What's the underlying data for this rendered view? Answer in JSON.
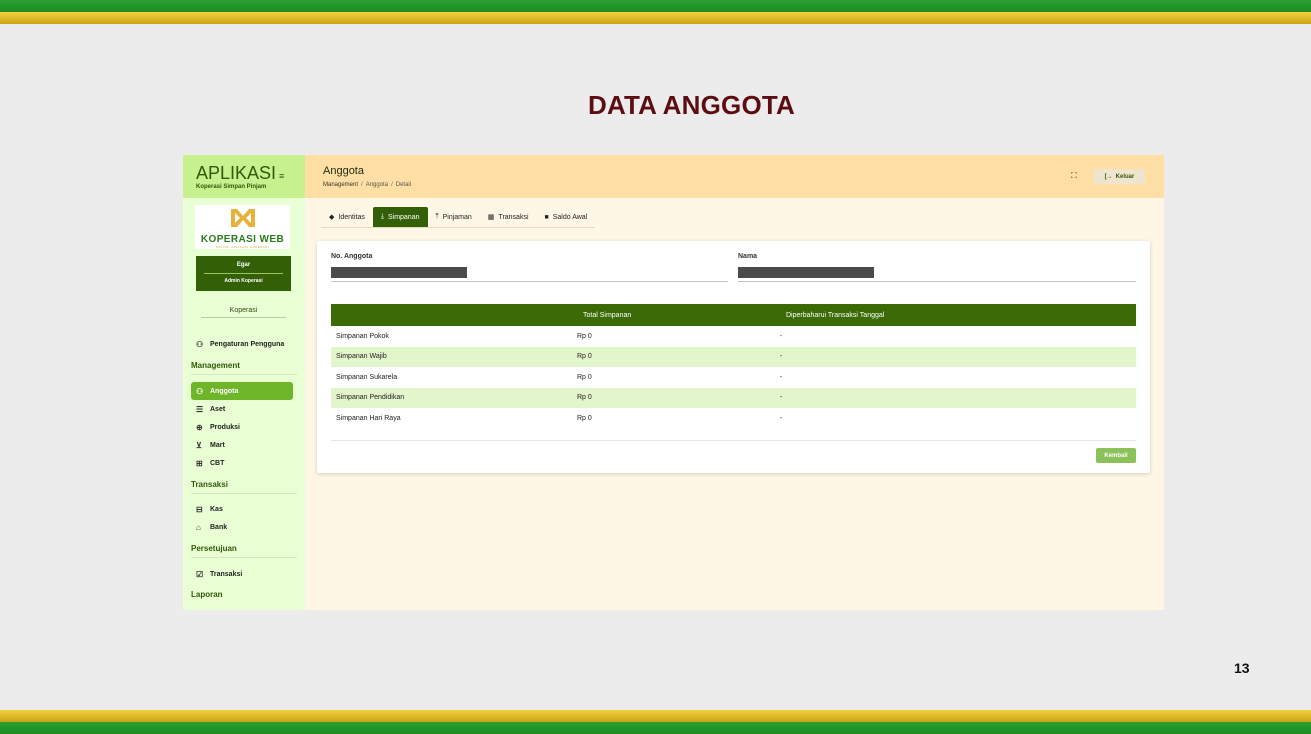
{
  "slide": {
    "title": "DATA ANGGOTA",
    "page_number": "13"
  },
  "sidebar": {
    "app_name": "APLIKASI",
    "app_subtitle": "Koperasi Simpan Pinjam",
    "logo_text": "KOPERASI WEB",
    "logo_tagline": "SOLUSI APLIKASI KOPERASI",
    "user_name": "Egar",
    "user_role": "Admin Koperasi",
    "org_label": "Koperasi",
    "items": [
      {
        "label": "Pengaturan Pengguna",
        "icon": "users-icon"
      },
      {
        "label": "Anggota",
        "icon": "users-icon",
        "active": true
      },
      {
        "label": "Aset",
        "icon": "server-icon"
      },
      {
        "label": "Produksi",
        "icon": "globe-icon"
      },
      {
        "label": "Mart",
        "icon": "cart-icon"
      },
      {
        "label": "CBT",
        "icon": "building-icon"
      },
      {
        "label": "Kas",
        "icon": "inbox-icon"
      },
      {
        "label": "Bank",
        "icon": "home-icon"
      },
      {
        "label": "Transaksi",
        "icon": "check-square-icon"
      }
    ],
    "sections": [
      "Management",
      "Transaksi",
      "Persetujuan",
      "Laporan"
    ]
  },
  "header": {
    "title": "Anggota",
    "breadcrumb": [
      "Management",
      "Anggota",
      "Detail"
    ],
    "logout_label": "Keluar"
  },
  "tabs": [
    {
      "label": "Identitas",
      "icon": "tag-icon"
    },
    {
      "label": "Simpanan",
      "icon": "download-icon",
      "active": true
    },
    {
      "label": "Pinjaman",
      "icon": "upload-icon"
    },
    {
      "label": "Transaksi",
      "icon": "calendar-icon"
    },
    {
      "label": "Saldo Awal",
      "icon": "book-icon"
    }
  ],
  "form": {
    "no_anggota_label": "No. Anggota",
    "nama_label": "Nama"
  },
  "table": {
    "headers": [
      "",
      "Total Simpanan",
      "Diperbaharui Transaksi Tanggal"
    ],
    "rows": [
      [
        "Simpanan Pokok",
        "Rp 0",
        "-"
      ],
      [
        "Simpanan Wajib",
        "Rp 0",
        "-"
      ],
      [
        "Simpanan Sukarela",
        "Rp 0",
        "-"
      ],
      [
        "Simpanan Pendidikan",
        "Rp 0",
        "-"
      ],
      [
        "Simpanan Hari Raya",
        "Rp 0",
        "-"
      ]
    ]
  },
  "buttons": {
    "back_label": "Kembali"
  },
  "colors": {
    "accent": "#335f07",
    "active_nav": "#6eb52a",
    "header_bg": "#ffdfa3",
    "title_color": "#5c0d12"
  }
}
